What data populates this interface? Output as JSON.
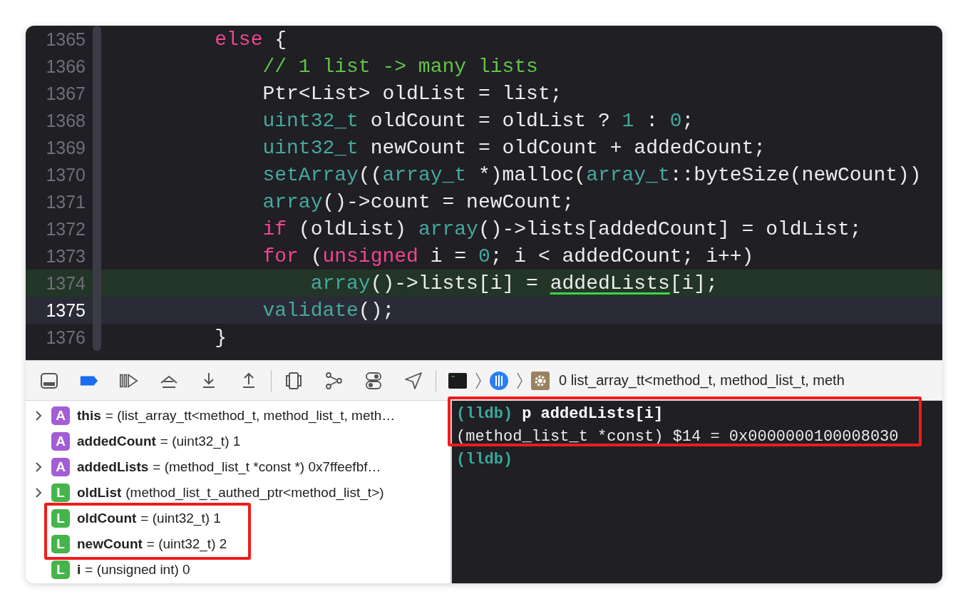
{
  "editor": {
    "lines": [
      {
        "number": "1365",
        "execution_point": false,
        "cursor": false,
        "tokens": [
          {
            "kind": "keyword",
            "text": "         else"
          },
          {
            "kind": "plain",
            "text": " {"
          }
        ]
      },
      {
        "number": "1366",
        "execution_point": false,
        "cursor": false,
        "tokens": [
          {
            "kind": "comment",
            "text": "             // 1 list -> many lists"
          }
        ]
      },
      {
        "number": "1367",
        "execution_point": false,
        "cursor": false,
        "tokens": [
          {
            "kind": "plain",
            "text": "             Ptr<List> oldList = list;"
          }
        ]
      },
      {
        "number": "1368",
        "execution_point": false,
        "cursor": false,
        "tokens": [
          {
            "kind": "type",
            "text": "             uint32_t"
          },
          {
            "kind": "plain",
            "text": " oldCount = oldList ? "
          },
          {
            "kind": "number",
            "text": "1"
          },
          {
            "kind": "plain",
            "text": " : "
          },
          {
            "kind": "number",
            "text": "0"
          },
          {
            "kind": "plain",
            "text": ";"
          }
        ]
      },
      {
        "number": "1369",
        "execution_point": false,
        "cursor": false,
        "tokens": [
          {
            "kind": "type",
            "text": "             uint32_t"
          },
          {
            "kind": "plain",
            "text": " newCount = oldCount + addedCount;"
          }
        ]
      },
      {
        "number": "1370",
        "execution_point": false,
        "cursor": false,
        "tokens": [
          {
            "kind": "type",
            "text": "             setArray"
          },
          {
            "kind": "plain",
            "text": "(("
          },
          {
            "kind": "type",
            "text": "array_t"
          },
          {
            "kind": "plain",
            "text": " *)malloc("
          },
          {
            "kind": "type",
            "text": "array_t"
          },
          {
            "kind": "plain",
            "text": "::byteSize(newCount))"
          }
        ]
      },
      {
        "number": "1371",
        "execution_point": false,
        "cursor": false,
        "tokens": [
          {
            "kind": "type",
            "text": "             array"
          },
          {
            "kind": "plain",
            "text": "()->count = newCount;"
          }
        ]
      },
      {
        "number": "1372",
        "execution_point": false,
        "cursor": false,
        "tokens": [
          {
            "kind": "keyword",
            "text": "             if"
          },
          {
            "kind": "plain",
            "text": " (oldList) "
          },
          {
            "kind": "type",
            "text": "array"
          },
          {
            "kind": "plain",
            "text": "()->lists[addedCount] = oldList;"
          }
        ]
      },
      {
        "number": "1373",
        "execution_point": false,
        "cursor": false,
        "tokens": [
          {
            "kind": "keyword",
            "text": "             for"
          },
          {
            "kind": "plain",
            "text": " ("
          },
          {
            "kind": "keyword",
            "text": "unsigned"
          },
          {
            "kind": "plain",
            "text": " i = "
          },
          {
            "kind": "number",
            "text": "0"
          },
          {
            "kind": "plain",
            "text": "; i < addedCount; i++)"
          }
        ]
      },
      {
        "number": "1374",
        "execution_point": true,
        "cursor": false,
        "tokens": [
          {
            "kind": "type",
            "text": "                 array"
          },
          {
            "kind": "plain",
            "text": "()->lists[i] = "
          },
          {
            "kind": "ref",
            "text": "addedLists"
          },
          {
            "kind": "plain",
            "text": "[i];"
          }
        ]
      },
      {
        "number": "1375",
        "execution_point": false,
        "cursor": true,
        "tokens": [
          {
            "kind": "type",
            "text": "             validate"
          },
          {
            "kind": "plain",
            "text": "();"
          }
        ]
      },
      {
        "number": "1376",
        "execution_point": false,
        "cursor": false,
        "tokens": [
          {
            "kind": "plain",
            "text": "         }"
          }
        ]
      }
    ]
  },
  "debug_bar": {
    "frame": "0 list_array_tt<method_t, method_list_t, meth"
  },
  "variables": [
    {
      "color": "#a35dd6",
      "badge": "A",
      "expandable": true,
      "name": "this",
      "value": "= (list_array_tt<method_t, method_list_t, meth…",
      "highlighted": false
    },
    {
      "color": "#a35dd6",
      "badge": "A",
      "expandable": false,
      "name": "addedCount",
      "value": "= (uint32_t) 1",
      "highlighted": false
    },
    {
      "color": "#a35dd6",
      "badge": "A",
      "expandable": true,
      "name": "addedLists",
      "value": "= (method_list_t *const *) 0x7ffeefbf…",
      "highlighted": false
    },
    {
      "color": "#45b44a",
      "badge": "L",
      "expandable": true,
      "name": "oldList",
      "value": "(method_list_t_authed_ptr<method_list_t>)",
      "highlighted": false
    },
    {
      "color": "#45b44a",
      "badge": "L",
      "expandable": false,
      "name": "oldCount",
      "value": "= (uint32_t) 1",
      "highlighted": true
    },
    {
      "color": "#45b44a",
      "badge": "L",
      "expandable": false,
      "name": "newCount",
      "value": "= (uint32_t) 2",
      "highlighted": true
    },
    {
      "color": "#45b44a",
      "badge": "L",
      "expandable": false,
      "name": "i",
      "value": "= (unsigned int) 0",
      "highlighted": false
    }
  ],
  "console": {
    "highlighted": true,
    "lines": [
      {
        "kind": "command",
        "prompt": "(lldb)",
        "text": "p addedLists[i]"
      },
      {
        "kind": "output",
        "text": "(method_list_t *const) $14 = 0x0000000100008030"
      },
      {
        "kind": "command",
        "prompt": "(lldb)"
      }
    ]
  }
}
